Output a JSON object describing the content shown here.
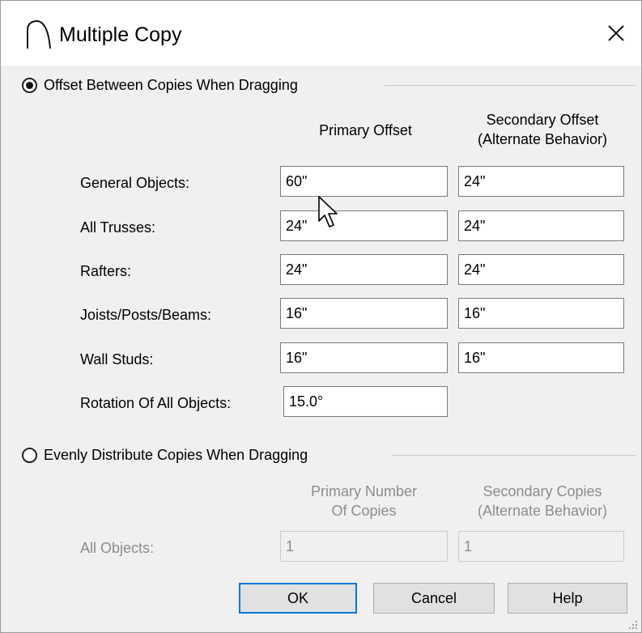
{
  "window": {
    "title": "Multiple Copy",
    "icon": "arch-icon",
    "close_label": "close-icon"
  },
  "offset_section": {
    "label": "Offset Between Copies When Dragging",
    "selected": true,
    "col_primary": "Primary Offset",
    "col_secondary_line1": "Secondary Offset",
    "col_secondary_line2": "(Alternate Behavior)",
    "rows": [
      {
        "label": "General Objects:",
        "primary": "60\"",
        "secondary": "24\""
      },
      {
        "label": "All Trusses:",
        "primary": "24\"",
        "secondary": "24\""
      },
      {
        "label": "Rafters:",
        "primary": "24\"",
        "secondary": "24\""
      },
      {
        "label": "Joists/Posts/Beams:",
        "primary": "16\"",
        "secondary": "16\""
      },
      {
        "label": "Wall Studs:",
        "primary": "16\"",
        "secondary": "16\""
      }
    ],
    "rotation_label": "Rotation Of All Objects:",
    "rotation_value": "15.0°"
  },
  "distribute_section": {
    "label": "Evenly Distribute Copies When Dragging",
    "selected": false,
    "col_primary_line1": "Primary Number",
    "col_primary_line2": "Of Copies",
    "col_secondary_line1": "Secondary Copies",
    "col_secondary_line2": "(Alternate Behavior)",
    "row_label": "All Objects:",
    "primary": "1",
    "secondary": "1"
  },
  "buttons": {
    "ok": "OK",
    "cancel": "Cancel",
    "help": "Help"
  }
}
